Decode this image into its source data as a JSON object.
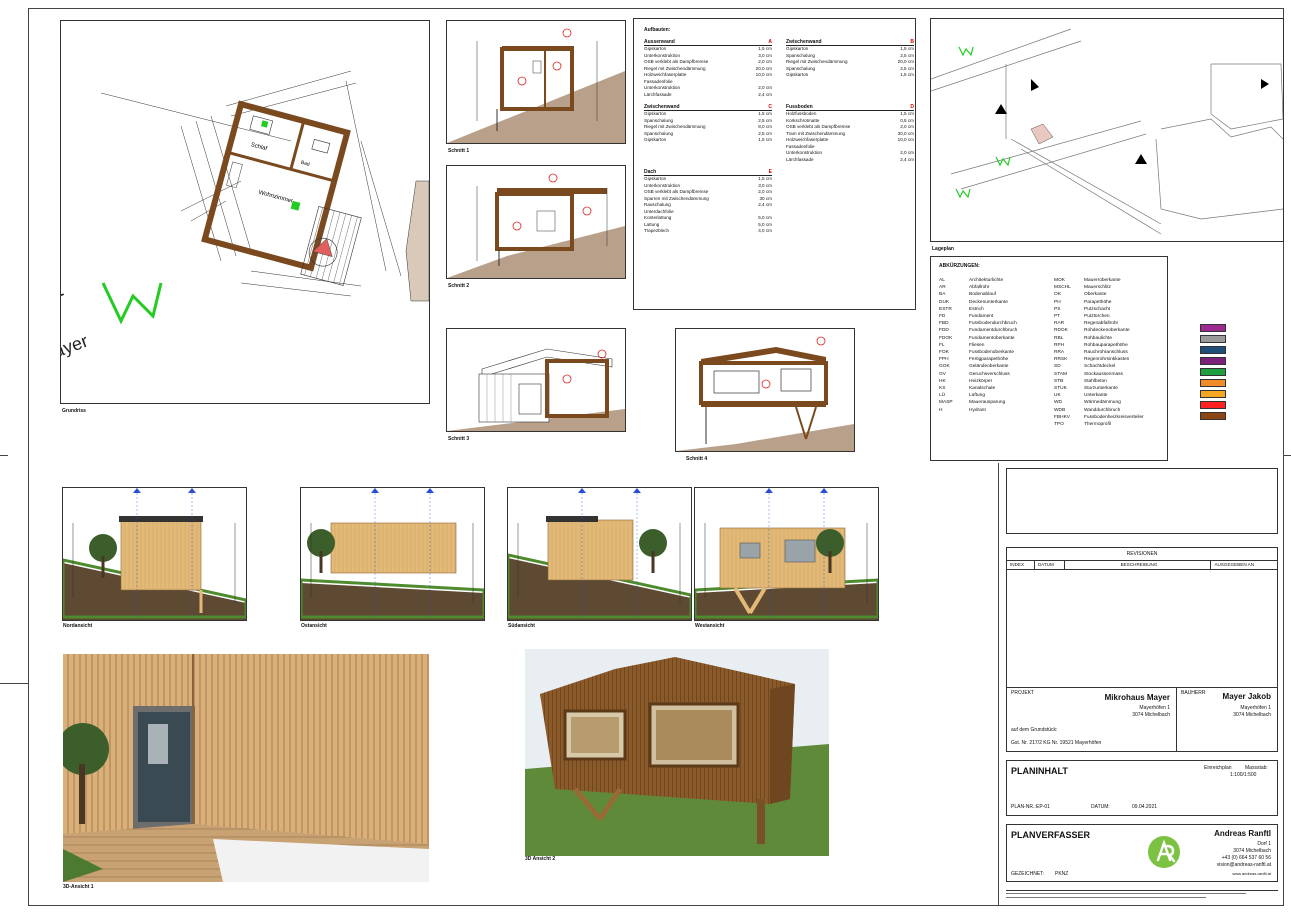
{
  "plans": {
    "grundriss": {
      "title": "Grundriss",
      "room_schlaf": "Schlaf",
      "room_wohnzimmer": "Wohnzimmer",
      "room_bad": "Bad",
      "wall_color": "#7a4a1e",
      "accent_green": "#22cc22"
    },
    "schnitt1": "Schnitt 1",
    "schnitt2": "Schnitt 2",
    "schnitt3": "Schnitt 3",
    "schnitt4": "Schnitt 4",
    "lageplan": "Lageplan",
    "views": [
      {
        "label": "Nordansicht"
      },
      {
        "label": "Ostansicht"
      },
      {
        "label": "Südansicht"
      },
      {
        "label": "Westansicht"
      }
    ],
    "render1": "3D-Ansicht 1",
    "render2": "3D Ansicht 2"
  },
  "aufbauten": {
    "heading": "Aufbauten:",
    "groups": [
      {
        "name": "Aussenwand",
        "code": "A",
        "layers": [
          {
            "m": "Gipskarton",
            "t": "1,5 cm"
          },
          {
            "m": "Unterkonstruktion",
            "t": "3,0 cm"
          },
          {
            "m": "OSB verklebt als Dampfbremse",
            "t": "2,0 cm"
          },
          {
            "m": "Riegel mit Zwischendämmung",
            "t": "20,0 cm"
          },
          {
            "m": "Holzweichfaserplatte",
            "t": "10,0 cm"
          },
          {
            "m": "Fassadenfolie",
            "t": ""
          },
          {
            "m": "Unterkonstruktion",
            "t": "2,0 cm"
          },
          {
            "m": "Lärchfassade",
            "t": "2,4 cm"
          }
        ]
      },
      {
        "name": "Zwischenwand",
        "code": "B",
        "layers": [
          {
            "m": "Gipskarton",
            "t": "1,5 cm"
          },
          {
            "m": "Spanschalung",
            "t": "2,5 cm"
          },
          {
            "m": "Riegel mit Zwischendämmung",
            "t": "20,0 cm"
          },
          {
            "m": "Spanschalung",
            "t": "2,5 cm"
          },
          {
            "m": "Gipskarton",
            "t": "1,5 cm"
          }
        ]
      },
      {
        "name": "Zwischenwand",
        "code": "C",
        "layers": [
          {
            "m": "Gipskarton",
            "t": "1,5 cm"
          },
          {
            "m": "Spanschalung",
            "t": "2,5 cm"
          },
          {
            "m": "Riegel mit Zwischendämmung",
            "t": "8,0 cm"
          },
          {
            "m": "Spanschalung",
            "t": "2,5 cm"
          },
          {
            "m": "Gipskarton",
            "t": "1,5 cm"
          }
        ]
      },
      {
        "name": "Fussboden",
        "code": "D",
        "layers": [
          {
            "m": "Holzfussboden",
            "t": "1,5 cm"
          },
          {
            "m": "Korkschrotmatte",
            "t": "0,5 cm"
          },
          {
            "m": "OSB verklebt als Dampfbremse",
            "t": "2,0 cm"
          },
          {
            "m": "Tram mit Zwischendämmung",
            "t": "30,0 cm"
          },
          {
            "m": "Holzweichfaserplatte",
            "t": "10,0 cm"
          },
          {
            "m": "Fassadenfolie",
            "t": ""
          },
          {
            "m": "Unterkonstruktion",
            "t": "2,0 cm"
          },
          {
            "m": "Lärchfassade",
            "t": "2,4 cm"
          }
        ]
      },
      {
        "name": "Dach",
        "code": "E",
        "layers": [
          {
            "m": "Gipskarton",
            "t": "1,5 cm"
          },
          {
            "m": "Unterkonstruktion",
            "t": "3,0 cm"
          },
          {
            "m": "OSB verklebt als Dampfbremse",
            "t": "2,0 cm"
          },
          {
            "m": "Sparren mit Zwischendämmung",
            "t": "30 cm"
          },
          {
            "m": "Rauschalung",
            "t": "2,4 cm"
          },
          {
            "m": "Unterdachfolie",
            "t": ""
          },
          {
            "m": "Konterlattung",
            "t": "5,0 cm"
          },
          {
            "m": "Lattung",
            "t": "5,0 cm"
          },
          {
            "m": "Trapezblech",
            "t": "4,0 cm"
          }
        ]
      }
    ]
  },
  "abkuerzungen": {
    "heading": "ABKÜRZUNGEN:",
    "col1": [
      [
        "AL",
        "Architekturlichte"
      ],
      [
        "AR",
        "Abfallrohr"
      ],
      [
        "BA",
        "Bodenablauf"
      ],
      [
        "DUK",
        "Deckenunterkante"
      ],
      [
        "ESTR",
        "Estrich"
      ],
      [
        "FD",
        "Fundament"
      ],
      [
        "FBD",
        "Fussbodendurchbruch"
      ],
      [
        "FDD",
        "Fundamentdurchbruch"
      ],
      [
        "FDOK",
        "Fundamentoberkante"
      ],
      [
        "FL",
        "Fliesen"
      ],
      [
        "FOK",
        "Fussbodenoberkante"
      ],
      [
        "FPH",
        "Fertigparapethöhe"
      ],
      [
        "GOK",
        "Geländeoberkante"
      ],
      [
        "GV",
        "Geruchsverschluss"
      ],
      [
        "HK",
        "Heizkörper"
      ],
      [
        "KS",
        "Kanalschale"
      ],
      [
        "LÜ",
        "Lüftung"
      ],
      [
        "MASP",
        "Mauerausparung"
      ],
      [
        "H",
        "Hydrant"
      ]
    ],
    "col2": [
      [
        "MOK",
        "Mauerroberkante"
      ],
      [
        "MSCHL",
        "Mauerschlitz"
      ],
      [
        "OK",
        "Oberkante"
      ],
      [
        "PH",
        "Parapethöhe"
      ],
      [
        "PS",
        "Putzschacht"
      ],
      [
        "PT",
        "Putztürchen"
      ],
      [
        "RAR",
        "Regenabfallrohr"
      ],
      [
        "RDOK",
        "Rohdeckenoberkante"
      ],
      [
        "RBL",
        "Rohbaulichte"
      ],
      [
        "RPH",
        "Rohbauparapethöhe"
      ],
      [
        "RRA",
        "Rauchrohranschluss"
      ],
      [
        "RRSK",
        "Regenrohrsinkkasten"
      ],
      [
        "SD",
        "Schachtdeckel"
      ],
      [
        "STAM",
        "Stockaussenmass"
      ],
      [
        "STB",
        "Stahlbeton"
      ],
      [
        "STUK",
        "Sturzunterkante"
      ],
      [
        "UK",
        "Unterkante"
      ],
      [
        "WD",
        "Wärmedämmung"
      ],
      [
        "WDB",
        "Wanddurchbruch"
      ],
      [
        "FBHKV",
        "Fussbodenheizkreisverteiler"
      ],
      [
        "TPO",
        "Thermoprofil"
      ]
    ]
  },
  "legend": [
    {
      "color": "#9b2b8e"
    },
    {
      "color": "#9a9a9a"
    },
    {
      "color": "#1f4e79"
    },
    {
      "color": "#7a1f7a"
    },
    {
      "color": "#1e9e3e"
    },
    {
      "color": "#f28c28"
    },
    {
      "color": "#f5a623"
    },
    {
      "color": "#ff2020"
    },
    {
      "color": "#8b4513"
    }
  ],
  "revisionen": {
    "heading": "REVISIONEN",
    "cols": [
      "INDEX",
      "DATUM",
      "BESCHREIBUNG",
      "AUSGEGEBEN AN"
    ]
  },
  "projekt": {
    "label": "PROJEKT",
    "name": "Mikrohaus Mayer",
    "addr1": "Mayerhöfen 1",
    "addr2": "3074 Michelbach",
    "line1": "auf dem Grundstück:",
    "line2": "Gst. Nr. 217/2 KG Nr. 19521 Mayerhöfen"
  },
  "bauherr": {
    "label": "BAUHERR",
    "name": "Mayer Jakob",
    "addr1": "Mayerhöfen 1",
    "addr2": "3074 Michelbach"
  },
  "planinhalt": {
    "title": "PLANINHALT",
    "type": "Einreichplan",
    "massstab_label": "Massstab:",
    "massstab": "1:100/1:500",
    "plannr_label": "PLAN-NR.:",
    "plannr": "EP-01",
    "datum_label": "DATUM:",
    "datum": "09.04.2021"
  },
  "planverfasser": {
    "title": "PLANVERFASSER",
    "name": "Andreas Ranftl",
    "addr1": "Dorf 1",
    "addr2": "3074 Michelbach",
    "phone": "+43 (0) 664 537 60 56",
    "email": "vision@andreas-ranftl.at",
    "web": "www.andreas-ranftl.at",
    "gezeichnet_label": "GEZEICHNET:",
    "gezeichnet": "PKNZ",
    "logo_color": "#7cc242"
  }
}
